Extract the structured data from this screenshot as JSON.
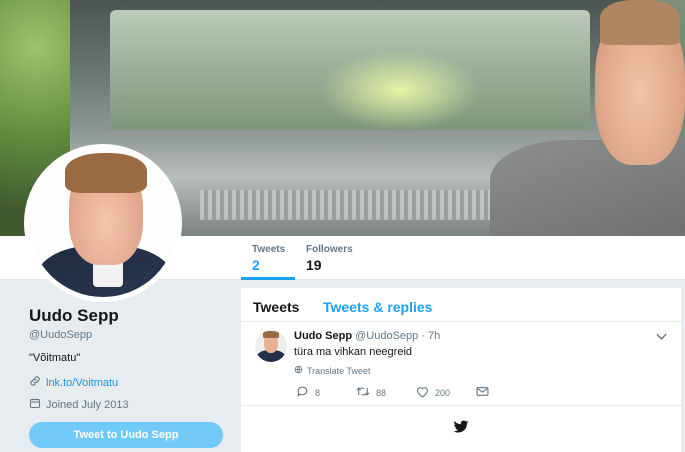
{
  "profile": {
    "name": "Uudo Sepp",
    "handle": "@UudoSepp",
    "bio": "\"Võitmatu\"",
    "link": "lnk.to/Voitmatu",
    "joined": "Joined July 2013",
    "tweet_to_label": "Tweet to Uudo Sepp"
  },
  "nav": {
    "stats": [
      {
        "label": "Tweets",
        "value": "2"
      },
      {
        "label": "Followers",
        "value": "19"
      }
    ]
  },
  "timeline": {
    "tabs": [
      "Tweets",
      "Tweets & replies"
    ],
    "tweet": {
      "name": "Uudo Sepp",
      "handle": "@UudoSepp",
      "time": "· 7h",
      "text": "türa ma vihkan neegreid",
      "translate": "Translate Tweet",
      "replies": "8",
      "retweets": "88",
      "likes": "200"
    }
  },
  "colors": {
    "accent": "#1da1f2",
    "tweet_button": "#71c9f8",
    "background": "#e6ecf0"
  },
  "icons": [
    "link-icon",
    "calendar-icon",
    "globe-icon",
    "reply-icon",
    "retweet-icon",
    "heart-icon",
    "envelope-icon",
    "chevron-down-icon",
    "twitter-bird-icon"
  ]
}
